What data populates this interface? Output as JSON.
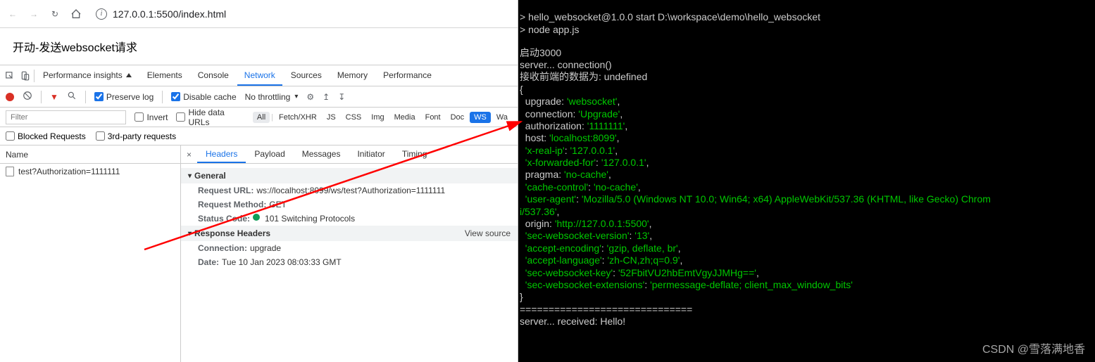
{
  "browser": {
    "url": "127.0.0.1:5500/index.html"
  },
  "page": {
    "body_text": "开动-发送websocket请求"
  },
  "devtools": {
    "tabs": {
      "perf_insights": "Performance insights",
      "elements": "Elements",
      "console": "Console",
      "network": "Network",
      "sources": "Sources",
      "memory": "Memory",
      "performance": "Performance"
    },
    "toolbar": {
      "preserve_log": "Preserve log",
      "disable_cache": "Disable cache",
      "throttling": "No throttling"
    },
    "filter": {
      "placeholder": "Filter",
      "invert": "Invert",
      "hide_urls": "Hide data URLs",
      "types": [
        "All",
        "Fetch/XHR",
        "JS",
        "CSS",
        "Img",
        "Media",
        "Font",
        "Doc",
        "WS",
        "Wa"
      ]
    },
    "filter2": {
      "blocked": "Blocked Requests",
      "thirdparty": "3rd-party requests"
    },
    "name_header": "Name",
    "request_name": "test?Authorization=1111111",
    "detail_tabs": {
      "headers": "Headers",
      "payload": "Payload",
      "messages": "Messages",
      "initiator": "Initiator",
      "timing": "Timing"
    },
    "general": {
      "title": "General",
      "request_url_k": "Request URL:",
      "request_url_v": "ws://localhost:8099/ws/test?Authorization=1111111",
      "request_method_k": "Request Method:",
      "request_method_v": "GET",
      "status_code_k": "Status Code:",
      "status_code_v": "101 Switching Protocols"
    },
    "response_headers": {
      "title": "Response Headers",
      "view_source": "View source",
      "connection_k": "Connection:",
      "connection_v": "upgrade",
      "date_k": "Date:",
      "date_v": "Tue  10 Jan 2023 08:03:33 GMT"
    }
  },
  "terminal": {
    "line1_a": "> hello_websocket@1.0.0 start D:\\workspace\\demo\\hello_websocket",
    "line2": "> node app.js",
    "line3": "启动3000",
    "line4": "server... connection()",
    "line5": "接收前端的数据为: undefined",
    "headers": {
      "upgrade": "'websocket'",
      "connection": "'Upgrade'",
      "authorization": "'1111111'",
      "host": "'localhost:8099'",
      "x_real_ip": "'127.0.0.1'",
      "x_forwarded_for": "'127.0.0.1'",
      "pragma": "'no-cache'",
      "cache_control": "'no-cache'",
      "user_agent": "'Mozilla/5.0 (Windows NT 10.0; Win64; x64) AppleWebKit/537.36 (KHTML, like Gecko) Chrom",
      "ua2": "i/537.36'",
      "origin": "'http://127.0.0.1:5500'",
      "ws_version": "'13'",
      "accept_encoding": "'gzip, deflate, br'",
      "accept_language": "'zh-CN,zh;q=0.9'",
      "ws_key": "'52FbitVU2hbEmtVgyJJMHg=='",
      "ws_ext": "'permessage-deflate; client_max_window_bits'"
    },
    "sep": "==============================",
    "received": "server... received: Hello!"
  },
  "watermark": "CSDN @雪落满地香"
}
